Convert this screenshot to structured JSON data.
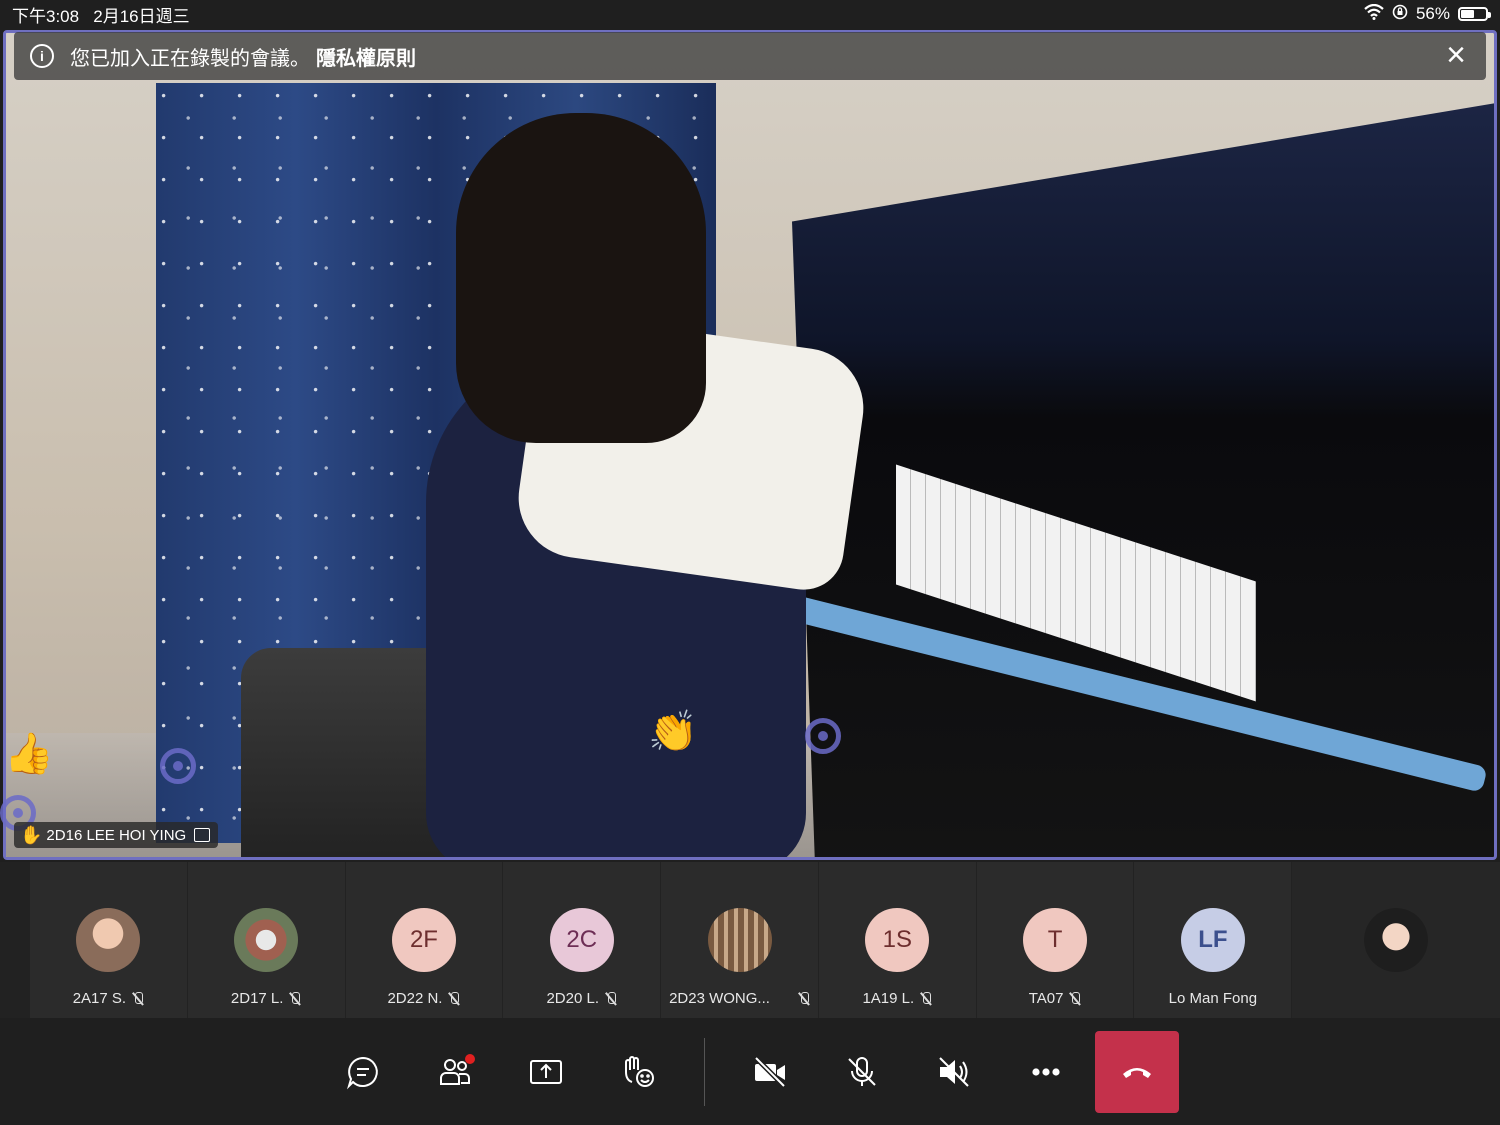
{
  "status_bar": {
    "time": "下午3:08",
    "date": "2月16日週三",
    "battery": "56%",
    "battery_level": 0.56
  },
  "banner": {
    "message": "您已加入正在錄製的會議。",
    "link": "隱私權原則"
  },
  "main_video": {
    "participant_name": "2D16 LEE HOI YING"
  },
  "participants": [
    {
      "name": "2A17 S.",
      "avatar": "photo-icon",
      "muted": true
    },
    {
      "name": "2D17 L.",
      "avatar": "photo-icon",
      "muted": true
    },
    {
      "name": "2D22 N.",
      "initials": "2F",
      "muted": true
    },
    {
      "name": "2D20 L.",
      "initials": "2C",
      "muted": true
    },
    {
      "name": "2D23 WONG...",
      "avatar": "photo-icon",
      "muted": true
    },
    {
      "name": "1A19 L.",
      "initials": "1S",
      "muted": true
    },
    {
      "name": "TA07",
      "initials": "T",
      "muted": true
    },
    {
      "name": "Lo Man Fong",
      "initials": "LF",
      "muted": false
    },
    {
      "name": "",
      "avatar": "self-photo-icon",
      "muted": false
    }
  ],
  "controls": {
    "chat": "chat-icon",
    "participants": "people-icon",
    "share": "share-icon",
    "reactions": "raise-hand-icon",
    "camera": "camera-off-icon",
    "mic": "mic-off-icon",
    "speaker": "speaker-off-icon",
    "more": "more-icon",
    "hangup": "hangup-icon"
  },
  "colors": {
    "hangup": "#c4314b",
    "speaker_highlight": "#6f6fc0"
  }
}
